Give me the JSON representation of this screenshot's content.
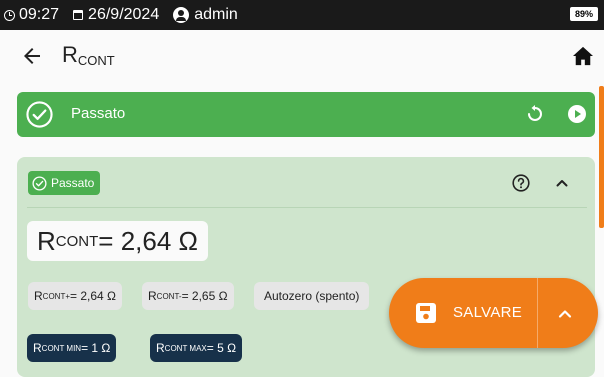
{
  "status_bar": {
    "time": "09:27",
    "date": "26/9/2024",
    "user": "admin",
    "battery": "89%"
  },
  "app_bar": {
    "title_main": "R",
    "title_sub": "CONT"
  },
  "result_banner": {
    "label": "Passato",
    "color": "#4caf50"
  },
  "result_card": {
    "status_chip": "Passato",
    "reading": {
      "symbol": "R",
      "symbol_sub": "CONT",
      "value": " = 2,64 Ω"
    },
    "details": [
      {
        "symbol": "R",
        "sub": "CONT+",
        "value": " = 2,64 Ω"
      },
      {
        "symbol": "R",
        "sub": "CONT-",
        "value": " = 2,65 Ω"
      },
      {
        "text": "Autozero (spento)"
      }
    ],
    "limits": [
      {
        "symbol": "R",
        "sub": "CONT MIN",
        "value": " = 1 Ω"
      },
      {
        "symbol": "R",
        "sub": "CONT MAX",
        "value": " = 5 Ω"
      }
    ]
  },
  "save_fab": {
    "label": "SALVARE",
    "color": "#f07d19"
  }
}
